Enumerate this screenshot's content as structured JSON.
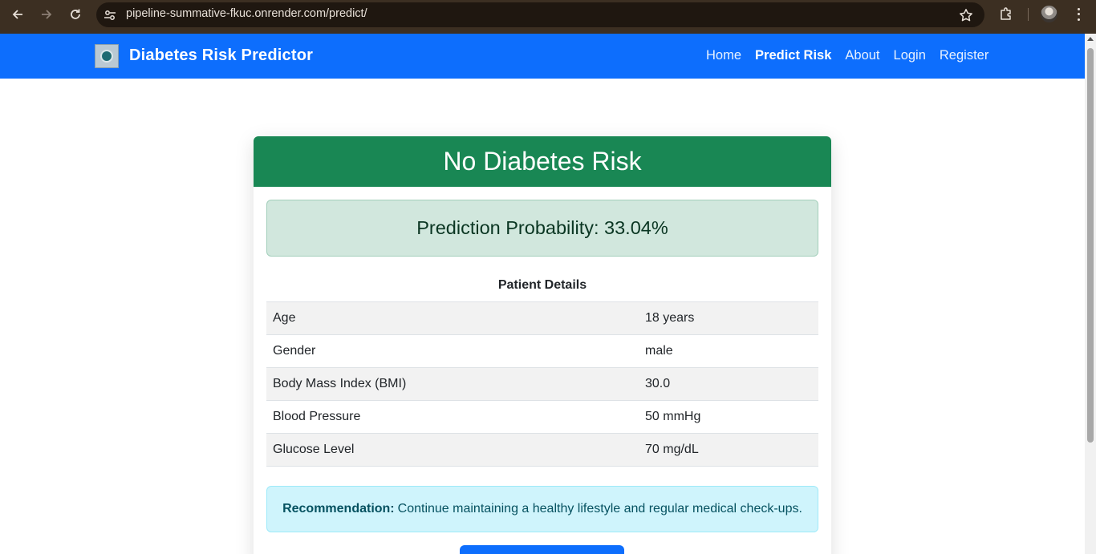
{
  "browser": {
    "url": "pipeline-summative-fkuc.onrender.com/predict/",
    "icons": [
      "back-arrow-icon",
      "forward-arrow-icon",
      "reload-icon",
      "site-settings-icon",
      "bookmark-star-icon",
      "extensions-icon",
      "profile-avatar",
      "more-menu-icon"
    ]
  },
  "navbar": {
    "brand": "Diabetes Risk Predictor",
    "links": [
      {
        "label": "Home",
        "active": false
      },
      {
        "label": "Predict Risk",
        "active": true
      },
      {
        "label": "About",
        "active": false
      },
      {
        "label": "Login",
        "active": false
      },
      {
        "label": "Register",
        "active": false
      }
    ],
    "color": "#0d6efd"
  },
  "result": {
    "heading": "No Diabetes Risk",
    "header_color": "#198754",
    "probability_text": "Prediction Probability: 33.04%",
    "details_title": "Patient Details",
    "details": [
      {
        "label": "Age",
        "value": "18 years"
      },
      {
        "label": "Gender",
        "value": "male"
      },
      {
        "label": "Body Mass Index (BMI)",
        "value": "30.0"
      },
      {
        "label": "Blood Pressure",
        "value": "50 mmHg"
      },
      {
        "label": "Glucose Level",
        "value": "70 mg/dL"
      }
    ],
    "recommendation_label": "Recommendation:",
    "recommendation_text": "Continue maintaining a healthy lifestyle and regular medical check-ups.",
    "button_label": ""
  }
}
